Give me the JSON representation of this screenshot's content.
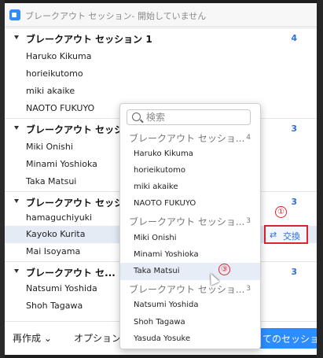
{
  "window": {
    "title": "ブレークアウト セッション- 開始していません"
  },
  "sessions": [
    {
      "name": "ブレークアウト セッション 1",
      "count": "4",
      "participants": [
        "Haruko Kikuma",
        "horieikutomo",
        "miki akaike",
        "NAOTO FUKUYO"
      ]
    },
    {
      "name": "ブレークアウト セッション",
      "count": "3",
      "participants": [
        "Miki Onishi",
        "Minami Yoshioka",
        "Taka Matsui"
      ]
    },
    {
      "name": "ブレークアウト セッション",
      "count": "3",
      "participants": [
        "hamaguchiyuki",
        "Kayoko Kurita",
        "Mai Isoyama"
      ]
    },
    {
      "name": "ブレークアウト セ...",
      "count": "3",
      "participants": [
        "Natsumi Yoshida",
        "Shoh Tagawa"
      ]
    }
  ],
  "swap_button": {
    "label": "交換",
    "icon": "swap-arrows-icon",
    "icon_glyph": "⇄"
  },
  "footer": {
    "recreate_label": "再作成 ⌄",
    "options_label": "オプション",
    "primary_label": "てのセッション"
  },
  "popup": {
    "search_placeholder": "検索",
    "groups": [
      {
        "name": "ブレークアウト セッショ...",
        "count": "4",
        "members": [
          "Haruko Kikuma",
          "horieikutomo",
          "miki akaike",
          "NAOTO FUKUYO"
        ]
      },
      {
        "name": "ブレークアウト セッショ...",
        "count": "3",
        "members": [
          "Miki Onishi",
          "Minami Yoshioka",
          "Taka Matsui"
        ]
      },
      {
        "name": "ブレークアウト セッショ...",
        "count": "3",
        "members": [
          "Natsumi Yoshida",
          "Shoh Tagawa",
          "Yasuda Yosuke"
        ]
      }
    ]
  },
  "annotations": {
    "marker_1": "①",
    "marker_3": "③"
  },
  "colors": {
    "accent_blue": "#2d8cff",
    "count_blue": "#2d6fd6",
    "highlight_red": "#e0232b",
    "selected_row": "#e4ebf5"
  }
}
